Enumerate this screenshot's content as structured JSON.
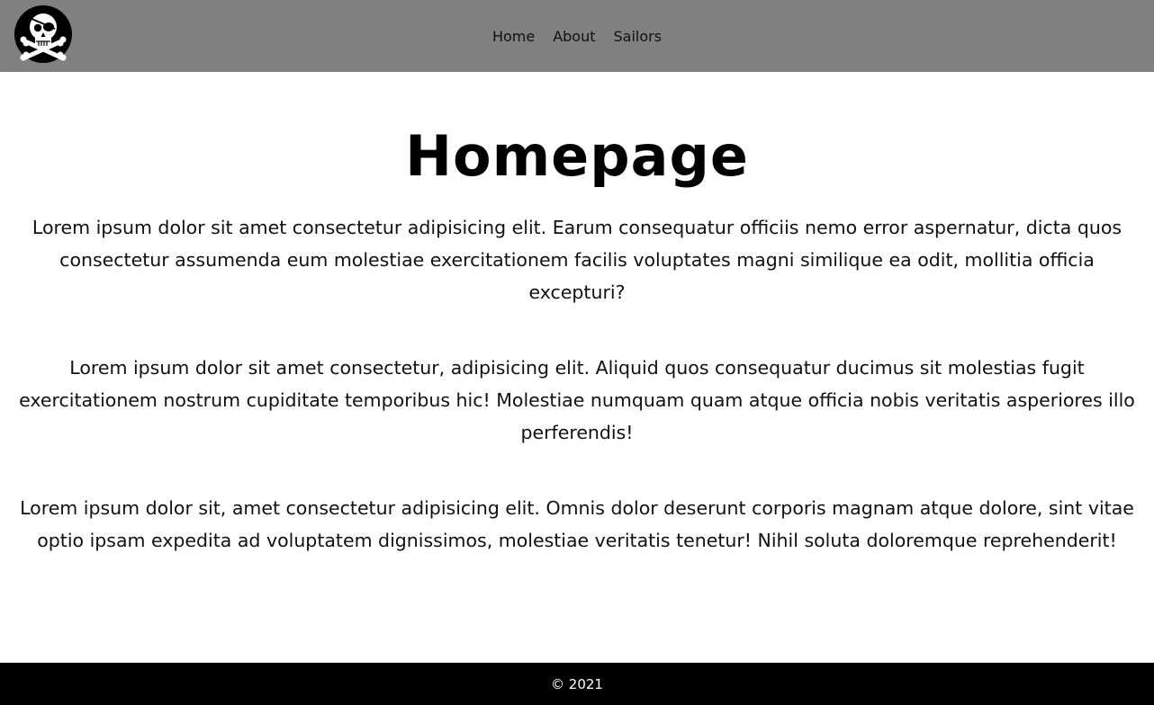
{
  "header": {
    "logo_icon": "jolly-roger-skull-icon",
    "background_color": "#808080",
    "nav": [
      {
        "label": "Home"
      },
      {
        "label": "About"
      },
      {
        "label": "Sailors"
      }
    ]
  },
  "main": {
    "title": "Homepage",
    "paragraphs": [
      "Lorem ipsum dolor sit amet consectetur adipisicing elit. Earum consequatur officiis nemo error aspernatur, dicta quos consectetur assumenda eum molestiae exercitationem facilis voluptates magni similique ea odit, mollitia officia excepturi?",
      "Lorem ipsum dolor sit amet consectetur, adipisicing elit. Aliquid quos consequatur ducimus sit molestias fugit exercitationem nostrum cupiditate temporibus hic! Molestiae numquam quam atque officia nobis veritatis asperiores illo perferendis!",
      "Lorem ipsum dolor sit, amet consectetur adipisicing elit. Omnis dolor deserunt corporis magnam atque dolore, sint vitae optio ipsam expedita ad voluptatem dignissimos, molestiae veritatis tenetur! Nihil soluta doloremque reprehenderit!"
    ]
  },
  "footer": {
    "text": "© 2021",
    "background_color": "#000000"
  }
}
